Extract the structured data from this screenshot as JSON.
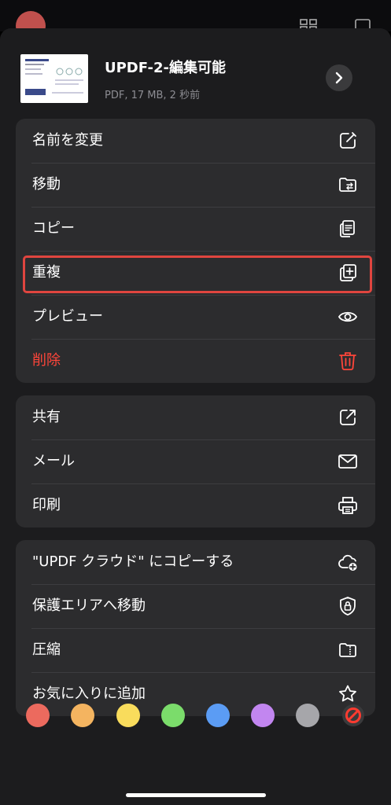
{
  "file": {
    "title": "UPDF-2-編集可能",
    "meta": "PDF, 17 MB, 2 秒前"
  },
  "groups": [
    {
      "items": [
        {
          "label": "名前を変更",
          "icon": "rename-icon"
        },
        {
          "label": "移動",
          "icon": "folder-move-icon"
        },
        {
          "label": "コピー",
          "icon": "copy-icon"
        },
        {
          "label": "重複",
          "icon": "duplicate-icon",
          "highlighted": true
        },
        {
          "label": "プレビュー",
          "icon": "eye-icon"
        },
        {
          "label": "削除",
          "icon": "trash-icon",
          "color": "#ff453a"
        }
      ]
    },
    {
      "items": [
        {
          "label": "共有",
          "icon": "share-icon"
        },
        {
          "label": "メール",
          "icon": "mail-icon"
        },
        {
          "label": "印刷",
          "icon": "printer-icon"
        }
      ]
    },
    {
      "items": [
        {
          "label": " \"UPDF クラウド\" にコピーする",
          "icon": "cloud-add-icon"
        },
        {
          "label": "保護エリアへ移動",
          "icon": "shield-lock-icon"
        },
        {
          "label": "圧縮",
          "icon": "zip-folder-icon"
        },
        {
          "label": "お気に入りに追加",
          "icon": "star-icon"
        }
      ]
    }
  ],
  "tag_colors": [
    "#ec6a5e",
    "#f4b460",
    "#f9dc5c",
    "#7bdc6b",
    "#5b9cf4",
    "#c286f0",
    "#a6a6aa"
  ],
  "no_color_icon": "prohibited-icon",
  "accent_colors": {
    "sheet": "#1c1c1e",
    "group": "#2c2c2e",
    "destructive": "#ff453a",
    "highlight_border": "#e0453f"
  }
}
